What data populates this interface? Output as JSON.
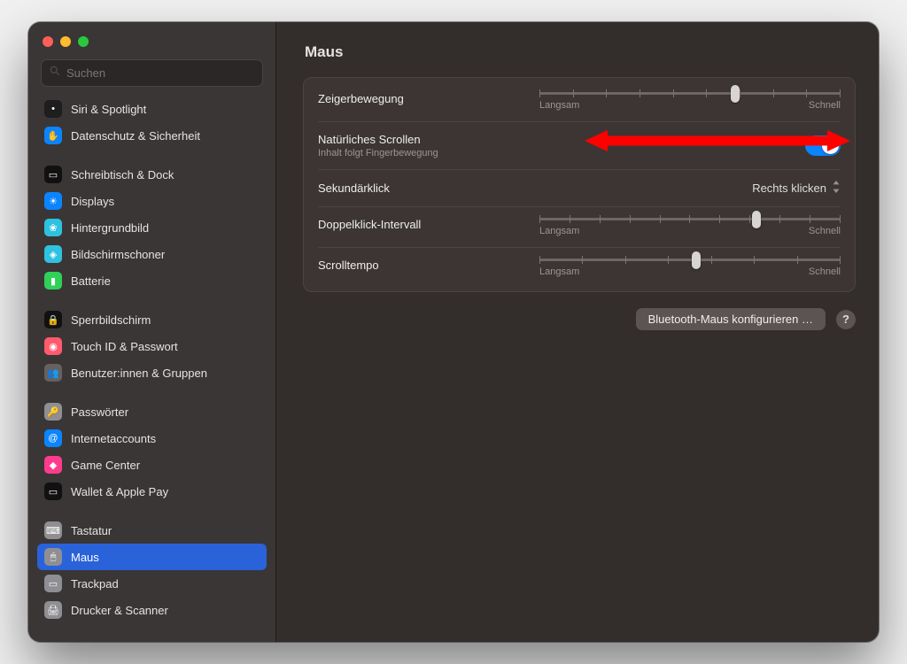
{
  "window": {
    "title": "Maus"
  },
  "search": {
    "placeholder": "Suchen"
  },
  "sidebar": {
    "groups": [
      {
        "items": [
          {
            "id": "siri",
            "label": "Siri & Spotlight",
            "color": "#1e1e1e",
            "glyph": "•"
          },
          {
            "id": "privacy",
            "label": "Datenschutz & Sicherheit",
            "color": "#0a84ff",
            "glyph": "✋"
          }
        ]
      },
      {
        "items": [
          {
            "id": "desktop",
            "label": "Schreibtisch & Dock",
            "color": "#111",
            "glyph": "▭"
          },
          {
            "id": "displays",
            "label": "Displays",
            "color": "#0a84ff",
            "glyph": "☀"
          },
          {
            "id": "wallpaper",
            "label": "Hintergrundbild",
            "color": "#2fc1e0",
            "glyph": "❀"
          },
          {
            "id": "screensaver",
            "label": "Bildschirmschoner",
            "color": "#2fc1e0",
            "glyph": "◈"
          },
          {
            "id": "battery",
            "label": "Batterie",
            "color": "#30d158",
            "glyph": "▮"
          }
        ]
      },
      {
        "items": [
          {
            "id": "lockscreen",
            "label": "Sperrbildschirm",
            "color": "#111",
            "glyph": "🔒"
          },
          {
            "id": "touchid",
            "label": "Touch ID & Passwort",
            "color": "#ff5a6e",
            "glyph": "◉"
          },
          {
            "id": "users",
            "label": "Benutzer:innen & Gruppen",
            "color": "#66615f",
            "glyph": "👥"
          }
        ]
      },
      {
        "items": [
          {
            "id": "passwords",
            "label": "Passwörter",
            "color": "#8e8e93",
            "glyph": "🔑"
          },
          {
            "id": "internet",
            "label": "Internetaccounts",
            "color": "#0a84ff",
            "glyph": "@"
          },
          {
            "id": "gamecenter",
            "label": "Game Center",
            "color": "#ff3b8e",
            "glyph": "◆"
          },
          {
            "id": "wallet",
            "label": "Wallet & Apple Pay",
            "color": "#111",
            "glyph": "▭"
          }
        ]
      },
      {
        "items": [
          {
            "id": "keyboard",
            "label": "Tastatur",
            "color": "#8e8e93",
            "glyph": "⌨"
          },
          {
            "id": "mouse",
            "label": "Maus",
            "color": "#8e8e93",
            "glyph": "🖱",
            "selected": true
          },
          {
            "id": "trackpad",
            "label": "Trackpad",
            "color": "#8e8e93",
            "glyph": "▭"
          },
          {
            "id": "printers",
            "label": "Drucker & Scanner",
            "color": "#8e8e93",
            "glyph": "🖨"
          }
        ]
      }
    ]
  },
  "settings": {
    "tracking": {
      "label": "Zeigerbewegung",
      "min_label": "Langsam",
      "max_label": "Schnell",
      "value_pct": 65
    },
    "natural": {
      "label": "Natürliches Scrollen",
      "sub": "Inhalt folgt Fingerbewegung",
      "on": true
    },
    "secondary": {
      "label": "Sekundärklick",
      "value": "Rechts klicken"
    },
    "double": {
      "label": "Doppelklick-Intervall",
      "min_label": "Langsam",
      "max_label": "Schnell",
      "value_pct": 72
    },
    "scroll": {
      "label": "Scrolltempo",
      "min_label": "Langsam",
      "max_label": "Schnell",
      "value_pct": 52
    }
  },
  "footer": {
    "bt_button": "Bluetooth-Maus konfigurieren …",
    "help": "?"
  }
}
